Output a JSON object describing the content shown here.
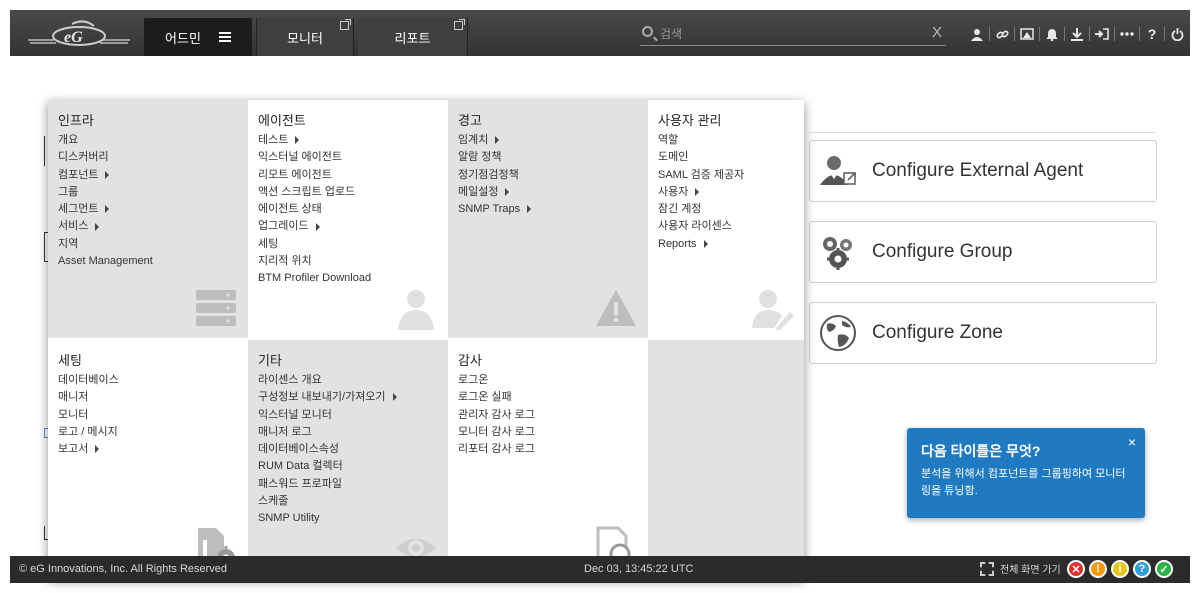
{
  "topbar": {
    "nav": [
      {
        "label": "어드민",
        "icon": "hamburger-icon"
      },
      {
        "label": "모니터",
        "icon": "external-link-icon"
      },
      {
        "label": "리포트",
        "icon": "external-link-icon"
      }
    ],
    "search": {
      "placeholder": "검색",
      "value": "",
      "clear": "X"
    },
    "icons": [
      "user-icon",
      "link-icon",
      "image-icon",
      "bell-icon",
      "download-icon",
      "login-icon",
      "more-icon",
      "help-icon",
      "power-icon"
    ]
  },
  "menu": {
    "cells": [
      {
        "title": "인프라",
        "items": [
          {
            "label": "개요",
            "submenu": false
          },
          {
            "label": "디스커버리",
            "submenu": false
          },
          {
            "label": "컴포넌트",
            "submenu": true
          },
          {
            "label": "그룹",
            "submenu": false
          },
          {
            "label": "세그먼트",
            "submenu": true
          },
          {
            "label": "서비스",
            "submenu": true
          },
          {
            "label": "지역",
            "submenu": false
          },
          {
            "label": "Asset Management",
            "submenu": false
          }
        ],
        "watermark": "server-stack-icon"
      },
      {
        "title": "에이전트",
        "items": [
          {
            "label": "테스트",
            "submenu": true
          },
          {
            "label": "익스터널 에이전트",
            "submenu": false
          },
          {
            "label": "리모트 에이전트",
            "submenu": false
          },
          {
            "label": "액션 스크립트 업로드",
            "submenu": false
          },
          {
            "label": "에이전트 상태",
            "submenu": false
          },
          {
            "label": "업그레이드",
            "submenu": true
          },
          {
            "label": "세팅",
            "submenu": false
          },
          {
            "label": "지리적 위치",
            "submenu": false
          },
          {
            "label": "BTM Profiler Download",
            "submenu": false
          }
        ],
        "watermark": "agent-person-icon"
      },
      {
        "title": "경고",
        "items": [
          {
            "label": "임계치",
            "submenu": true
          },
          {
            "label": "알람 정책",
            "submenu": false
          },
          {
            "label": "정기점검정책",
            "submenu": false
          },
          {
            "label": "메일설정",
            "submenu": true
          },
          {
            "label": "SNMP Traps",
            "submenu": true
          }
        ],
        "watermark": "warning-triangle-icon"
      },
      {
        "title": "사용자 관리",
        "items": [
          {
            "label": "역할",
            "submenu": false
          },
          {
            "label": "도메인",
            "submenu": false
          },
          {
            "label": "SAML 검증 제공자",
            "submenu": false
          },
          {
            "label": "사용자",
            "submenu": true
          },
          {
            "label": "잠긴 계정",
            "submenu": false
          },
          {
            "label": "사용자 라이센스",
            "submenu": false
          },
          {
            "label": "Reports",
            "submenu": true
          }
        ],
        "watermark": "user-edit-icon"
      },
      {
        "title": "세팅",
        "items": [
          {
            "label": "데이터베이스",
            "submenu": false
          },
          {
            "label": "매니저",
            "submenu": false
          },
          {
            "label": "모니터",
            "submenu": false
          },
          {
            "label": "로고 / 메시지",
            "submenu": false
          },
          {
            "label": "보고서",
            "submenu": true
          }
        ],
        "watermark": "document-gear-icon"
      },
      {
        "title": "기타",
        "items": [
          {
            "label": "라이센스 개요",
            "submenu": false
          },
          {
            "label": "구성정보 내보내기/가져오기",
            "submenu": true
          },
          {
            "label": "익스터널 모니터",
            "submenu": false
          },
          {
            "label": "매니저 로그",
            "submenu": false
          },
          {
            "label": "데이터베이스속성",
            "submenu": false
          },
          {
            "label": "RUM Data 컬렉터",
            "submenu": false
          },
          {
            "label": "패스워드 프로파일",
            "submenu": false
          },
          {
            "label": "스케줄",
            "submenu": false
          },
          {
            "label": "SNMP Utility",
            "submenu": false
          }
        ],
        "watermark": "eye-icon"
      },
      {
        "title": "감사",
        "items": [
          {
            "label": "로그온",
            "submenu": false
          },
          {
            "label": "로그온 실패",
            "submenu": false
          },
          {
            "label": "관리자 감사 로그",
            "submenu": false
          },
          {
            "label": "모니터 감사 로그",
            "submenu": false
          },
          {
            "label": "리포터 감사 로그",
            "submenu": false
          }
        ],
        "watermark": "document-search-icon"
      },
      {
        "title": "",
        "items": [],
        "watermark": ""
      }
    ]
  },
  "main": {
    "cards": [
      {
        "label": "Configure External Agent",
        "icon": "external-agent-icon"
      },
      {
        "label": "Configure Group",
        "icon": "group-gears-icon"
      },
      {
        "label": "Configure Zone",
        "icon": "globe-icon"
      }
    ]
  },
  "tip": {
    "title": "다음 타이틀은 무엇?",
    "body": "분석을 위해서 컴포넌트를 그룹핑하여 모니터링을 튜닝함.",
    "close": "×"
  },
  "footer": {
    "copyright": "© eG Innovations, Inc. All Rights Reserved",
    "datetime": "Dec 03, 13:45:22 UTC",
    "fullscreen": "전체 화면 가기",
    "status": [
      {
        "symbol": "✕",
        "color": "#e0332b",
        "name": "critical-status-icon"
      },
      {
        "symbol": "!",
        "color": "#f39c12",
        "name": "major-status-icon"
      },
      {
        "symbol": "i",
        "color": "#e6c619",
        "name": "minor-status-icon"
      },
      {
        "symbol": "?",
        "color": "#2e9fd8",
        "name": "unknown-status-icon"
      },
      {
        "symbol": "✓",
        "color": "#2bb34a",
        "name": "normal-status-icon"
      }
    ]
  }
}
